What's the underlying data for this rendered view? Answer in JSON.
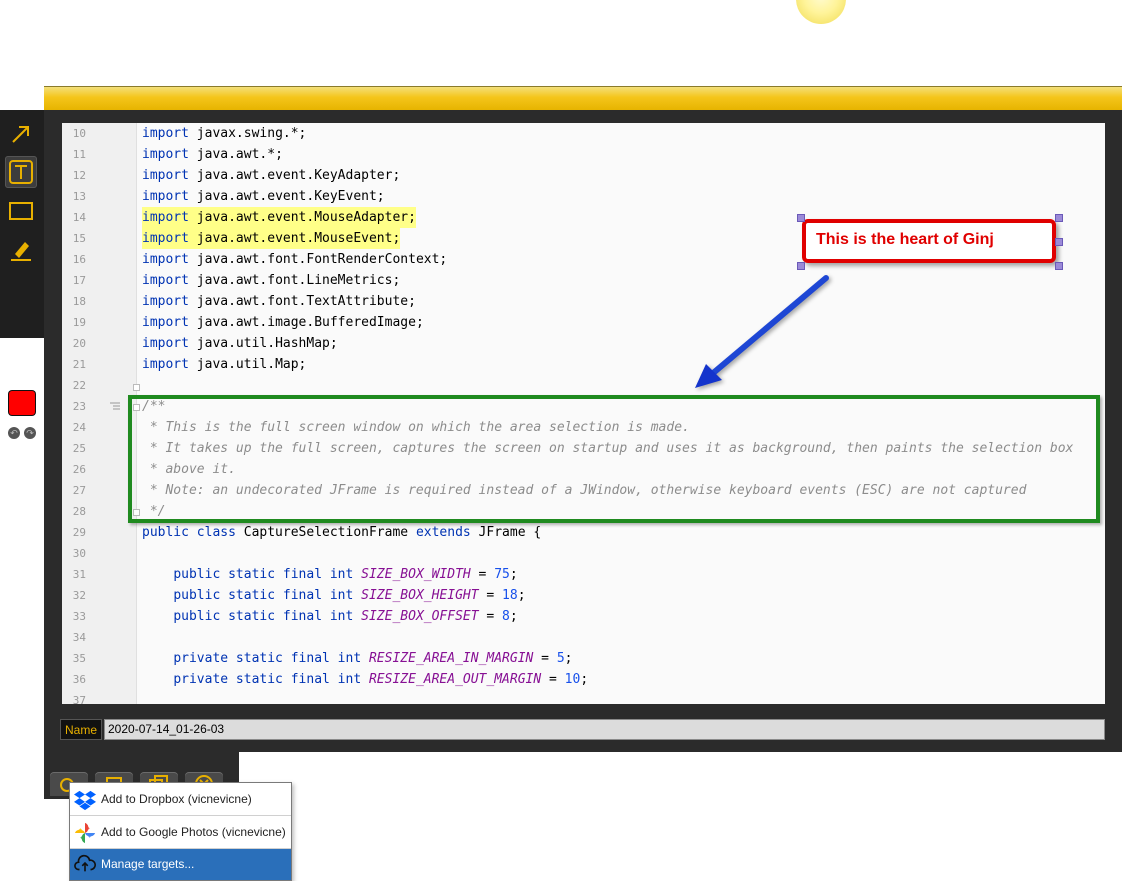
{
  "editor": {
    "lines": [
      {
        "n": "10",
        "tokens": [
          [
            "kw",
            "import"
          ],
          [
            "",
            "javax.swing.*;"
          ]
        ]
      },
      {
        "n": "11",
        "tokens": [
          [
            "kw",
            "import"
          ],
          [
            "",
            "java.awt.*;"
          ]
        ]
      },
      {
        "n": "12",
        "tokens": [
          [
            "kw",
            "import"
          ],
          [
            "",
            "java.awt.event.KeyAdapter;"
          ]
        ]
      },
      {
        "n": "13",
        "tokens": [
          [
            "kw",
            "import"
          ],
          [
            "",
            "java.awt.event.KeyEvent;"
          ]
        ]
      },
      {
        "n": "14",
        "hl": true,
        "tokens": [
          [
            "kw",
            "import"
          ],
          [
            "",
            "java.awt.event.MouseAdapter;"
          ]
        ]
      },
      {
        "n": "15",
        "hl": true,
        "tokens": [
          [
            "kw",
            "import"
          ],
          [
            "",
            "java.awt.event.MouseEvent;"
          ]
        ]
      },
      {
        "n": "16",
        "tokens": [
          [
            "kw",
            "import"
          ],
          [
            "",
            "java.awt.font.FontRenderContext;"
          ]
        ]
      },
      {
        "n": "17",
        "tokens": [
          [
            "kw",
            "import"
          ],
          [
            "",
            "java.awt.font.LineMetrics;"
          ]
        ]
      },
      {
        "n": "18",
        "tokens": [
          [
            "kw",
            "import"
          ],
          [
            "",
            "java.awt.font.TextAttribute;"
          ]
        ]
      },
      {
        "n": "19",
        "tokens": [
          [
            "kw",
            "import"
          ],
          [
            "",
            "java.awt.image.BufferedImage;"
          ]
        ]
      },
      {
        "n": "20",
        "tokens": [
          [
            "kw",
            "import"
          ],
          [
            "",
            "java.util.HashMap;"
          ]
        ]
      },
      {
        "n": "21",
        "tokens": [
          [
            "kw",
            "import"
          ],
          [
            "",
            "java.util.Map;"
          ]
        ]
      },
      {
        "n": "22",
        "tokens": []
      },
      {
        "n": "23",
        "tokens": [
          [
            "doc",
            "/**"
          ]
        ]
      },
      {
        "n": "24",
        "tokens": [
          [
            "doc",
            " * This is the full screen window on which the area selection is made."
          ]
        ]
      },
      {
        "n": "25",
        "tokens": [
          [
            "doc",
            " * It takes up the full screen, captures the screen on startup and uses it as background, then paints the selection box"
          ]
        ]
      },
      {
        "n": "26",
        "tokens": [
          [
            "doc",
            " * above it."
          ]
        ]
      },
      {
        "n": "27",
        "tokens": [
          [
            "doc",
            " * Note: an undecorated JFrame is required instead of a JWindow, otherwise keyboard events (ESC) are not captured"
          ]
        ]
      },
      {
        "n": "28",
        "tokens": [
          [
            "doc",
            " */"
          ]
        ]
      },
      {
        "n": "29",
        "tokens": [
          [
            "kw",
            "public class"
          ],
          [
            "",
            " CaptureSelectionFrame "
          ],
          [
            "kw",
            "extends"
          ],
          [
            "",
            " JFrame {"
          ]
        ]
      },
      {
        "n": "30",
        "tokens": []
      },
      {
        "n": "31",
        "tokens": [
          [
            "",
            "    "
          ],
          [
            "kw",
            "public static final int"
          ],
          [
            "",
            " "
          ],
          [
            "const",
            "SIZE_BOX_WIDTH"
          ],
          [
            "",
            " = "
          ],
          [
            "num",
            "75"
          ],
          [
            "",
            ";"
          ]
        ]
      },
      {
        "n": "32",
        "tokens": [
          [
            "",
            "    "
          ],
          [
            "kw",
            "public static final int"
          ],
          [
            "",
            " "
          ],
          [
            "const",
            "SIZE_BOX_HEIGHT"
          ],
          [
            "",
            " = "
          ],
          [
            "num",
            "18"
          ],
          [
            "",
            ";"
          ]
        ]
      },
      {
        "n": "33",
        "tokens": [
          [
            "",
            "    "
          ],
          [
            "kw",
            "public static final int"
          ],
          [
            "",
            " "
          ],
          [
            "const",
            "SIZE_BOX_OFFSET"
          ],
          [
            "",
            " = "
          ],
          [
            "num",
            "8"
          ],
          [
            "",
            ";"
          ]
        ]
      },
      {
        "n": "34",
        "tokens": []
      },
      {
        "n": "35",
        "tokens": [
          [
            "",
            "    "
          ],
          [
            "kw",
            "private static final int"
          ],
          [
            "",
            " "
          ],
          [
            "const",
            "RESIZE_AREA_IN_MARGIN"
          ],
          [
            "",
            " = "
          ],
          [
            "num",
            "5"
          ],
          [
            "",
            ";"
          ]
        ]
      },
      {
        "n": "36",
        "tokens": [
          [
            "",
            "    "
          ],
          [
            "kw",
            "private static final int"
          ],
          [
            "",
            " "
          ],
          [
            "const",
            "RESIZE_AREA_OUT_MARGIN"
          ],
          [
            "",
            " = "
          ],
          [
            "num",
            "10"
          ],
          [
            "",
            ";"
          ]
        ]
      },
      {
        "n": "37",
        "tokens": []
      }
    ]
  },
  "annotations": {
    "callout_text": "This is the heart of Ginj",
    "callout_color": "#e00000",
    "box_color": "#1f8a1f",
    "arrow_color": "#1a3fd6"
  },
  "toolbar": {
    "tools": [
      "arrow-icon",
      "text-icon",
      "rectangle-icon",
      "highlighter-icon"
    ],
    "active_tool": "text-icon",
    "current_color": "#ff0000"
  },
  "name_field": {
    "label": "Name",
    "value": "2020-07-14_01-26-03"
  },
  "share_menu": {
    "items": [
      {
        "label": "Add to Dropbox (vicnevicne)",
        "icon": "dropbox-icon"
      },
      {
        "label": "Add to Google Photos (vicnevicne)",
        "icon": "google-photos-icon"
      },
      {
        "label": "Manage targets...",
        "icon": "cloud-upload-icon"
      }
    ]
  },
  "colors": {
    "accent": "#f4c51a",
    "frame": "#2b2b2b",
    "menu_selected": "#2a6fba"
  }
}
